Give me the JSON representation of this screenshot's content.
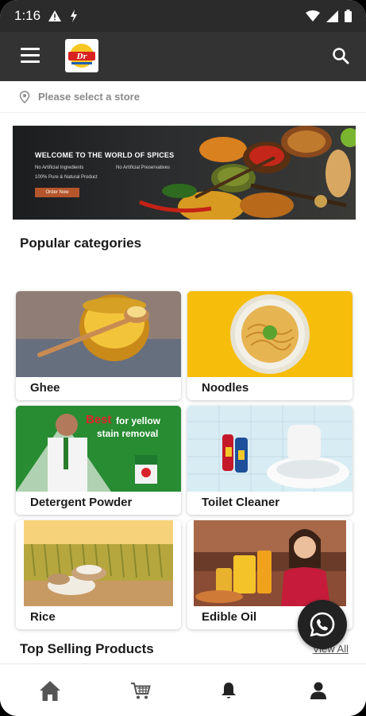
{
  "status_bar": {
    "time": "1:16"
  },
  "app_bar": {
    "logo_text": "Dr"
  },
  "store_selector": {
    "placeholder": "Please select a store"
  },
  "banner": {
    "title": "WELCOME TO THE WORLD OF SPICES",
    "features": [
      "No Artificial Ingredients",
      "No Artificial Preservatives",
      "100% Pure & Natural Product"
    ],
    "button_label": "Order Now"
  },
  "popular_categories": {
    "title": "Popular categories",
    "items": [
      {
        "label": "Ghee"
      },
      {
        "label": "Noodles"
      },
      {
        "label": "Detergent Powder",
        "badge_main": "Best",
        "badge_rest": "for yellow",
        "badge_line2": "stain removal"
      },
      {
        "label": "Toilet Cleaner"
      },
      {
        "label": "Rice"
      },
      {
        "label": "Edible Oil"
      }
    ]
  },
  "top_selling": {
    "title": "Top Selling Products",
    "view_all": "View All"
  },
  "colors": {
    "appbar": "#333333",
    "statusbar": "#2b2b2b",
    "accent": "#b5552b",
    "fab": "#222222"
  },
  "bottom_nav": {
    "items": [
      "home-icon",
      "cart-icon",
      "bell-icon",
      "profile-icon"
    ]
  }
}
